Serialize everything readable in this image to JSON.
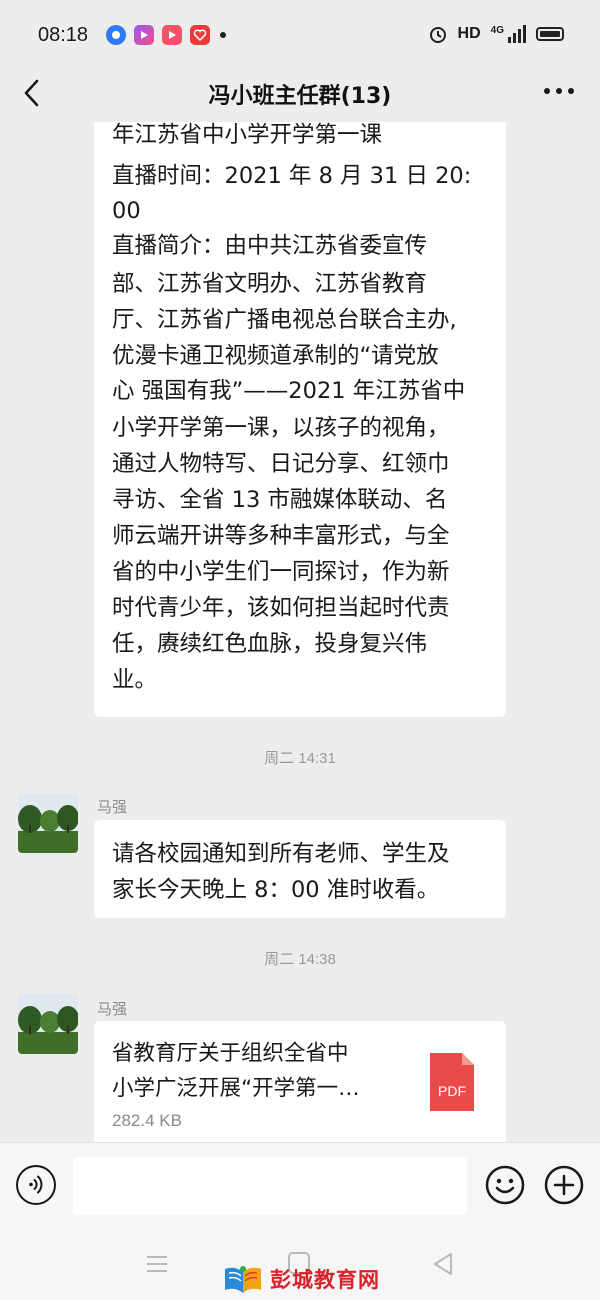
{
  "status_bar": {
    "time": "08:18",
    "network": "HD",
    "signal": "4G",
    "app_icons": [
      "baidu-icon",
      "video-app-icon",
      "play-app-icon",
      "heart-app-icon"
    ]
  },
  "header": {
    "title": "冯小班主任群(13)",
    "back_icon": "chevron-left-icon",
    "more_icon": "more-dots-icon"
  },
  "messages": [
    {
      "type": "text",
      "lines": [
        "年江苏省中小学开学第一课",
        "直播时间：2021 年 8 月 31 日 20:",
        "00",
        "直播简介：由中共江苏省委宣传",
        "部、江苏省文明办、江苏省教育",
        "厅、江苏省广播电视总台联合主办,",
        "优漫卡通卫视频道承制的“请党放",
        "心 强国有我”——2021 年江苏省中",
        "小学开学第一课，以孩子的视角，",
        "通过人物特写、日记分享、红领巾",
        "寻访、全省 13 市融媒体联动、名",
        "师云端开讲等多种丰富形式，与全",
        "省的中小学生们一同探讨，作为新",
        "时代青少年，该如何担当起时代责",
        "任，赓续红色血脉，投身复兴伟",
        "业。"
      ]
    },
    {
      "type": "time",
      "text": "周二 14:31"
    },
    {
      "type": "text",
      "sender": "马强",
      "lines": [
        "请各校园通知到所有老师、学生及",
        "家长今天晚上 8：00 准时收看。"
      ]
    },
    {
      "type": "time",
      "text": "周二 14:38"
    },
    {
      "type": "file",
      "sender": "马强",
      "file_name_lines": [
        "省教育厅关于组织全省中",
        "小学广泛开展“开学第一…"
      ],
      "file_size": "282.4 KB",
      "file_type": "PDF"
    }
  ],
  "input_bar": {
    "voice_icon": "voice-icon",
    "placeholder": "",
    "emoji_icon": "emoji-icon",
    "plus_icon": "plus-icon"
  },
  "nav_bar": {
    "menu_icon": "menu-icon",
    "home_icon": "home-icon",
    "back_icon": "back-triangle-icon"
  },
  "watermark": {
    "text": "彭城教育网"
  },
  "colors": {
    "background": "#ededed",
    "bubble": "#ffffff",
    "pdf_red": "#e94b48",
    "watermark_red": "#d8232a"
  }
}
